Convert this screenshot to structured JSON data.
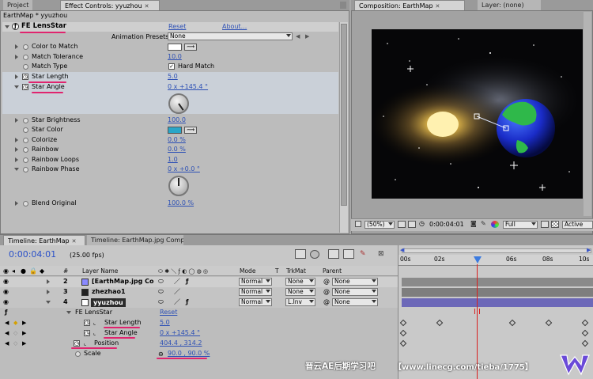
{
  "left_tabs": [
    "Project",
    "Effect Controls: yyuzhou"
  ],
  "right_tabs": [
    "Composition: EarthMap",
    "Layer: (none)"
  ],
  "effect_controls": {
    "breadcrumb": "EarthMap * yyuzhou",
    "effect_name": "FE LensStar",
    "reset": "Reset",
    "about": "About...",
    "presets_label": "Animation Presets:",
    "presets_value": "None",
    "props": [
      {
        "label": "Color to Match"
      },
      {
        "label": "Match Tolerance",
        "value": "10.0"
      },
      {
        "label": "Match Type",
        "value": "Hard Match"
      },
      {
        "label": "Star Length",
        "value": "5.0"
      },
      {
        "label": "Star Angle",
        "value": "0 x +145.4 °"
      },
      {
        "label": "Star Brightness",
        "value": "100.0"
      },
      {
        "label": "Star Color"
      },
      {
        "label": "Colorize",
        "value": "0.0 %"
      },
      {
        "label": "Rainbow",
        "value": "0.0 %"
      },
      {
        "label": "Rainbow Loops",
        "value": "1.0"
      },
      {
        "label": "Rainbow Phase",
        "value": "0 x +0.0 °"
      },
      {
        "label": "Blend Original",
        "value": "100.0 %"
      }
    ],
    "star_color_hex": "#29a6c8"
  },
  "composition": {
    "zoom": "(50%)",
    "timecode": "0:00:04:01",
    "resolution": "Full",
    "active_camera": "Active Cam"
  },
  "timeline": {
    "tabs": [
      "Timeline: EarthMap",
      "Timeline: EarthMap.jpg Comp 1"
    ],
    "timecode": "0:00:04:01",
    "fps": "(25.00 fps)",
    "headers": {
      "num": "#",
      "layer_name": "Layer Name",
      "mode": "Mode",
      "t": "T",
      "trkmat": "TrkMat",
      "parent": "Parent"
    },
    "layers": [
      {
        "num": "2",
        "name": "[EarthMap.jpg Co",
        "mode": "Normal",
        "trkmat": "None",
        "parent": "None"
      },
      {
        "num": "3",
        "name": "zhezhao1",
        "mode": "Normal",
        "trkmat": "None",
        "parent": "None"
      },
      {
        "num": "4",
        "name": "yyuzhou",
        "mode": "Normal",
        "trkmat": "L.Inv",
        "parent": "None"
      }
    ],
    "effect_name": "FE LensStar",
    "reset": "Reset",
    "props": [
      {
        "label": "Star Length",
        "value": "5.0"
      },
      {
        "label": "Star Angle",
        "value": "0 x +145.4 °"
      },
      {
        "label": "Position",
        "value": "404.4 , 314.2"
      },
      {
        "label": "Scale",
        "value": "90.0 , 90.0 %"
      }
    ],
    "ruler": [
      "0s",
      "02s",
      "04s",
      "06s",
      "08s",
      "10s"
    ],
    "ruler_first": "00s"
  },
  "watermark": {
    "cn": "晋云AE后期学习吧",
    "url": "【www.linecg.com/tieba/1775】"
  }
}
